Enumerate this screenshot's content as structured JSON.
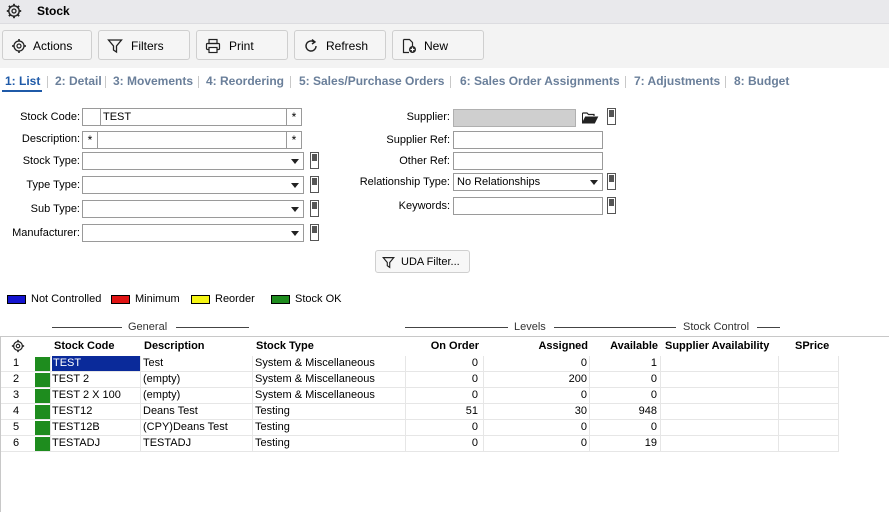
{
  "window": {
    "title": "Stock"
  },
  "toolbar": {
    "actions": "Actions",
    "filters": "Filters",
    "print": "Print",
    "refresh": "Refresh",
    "new": "New"
  },
  "tabs": [
    {
      "label": "1: List"
    },
    {
      "label": "2: Detail"
    },
    {
      "label": "3: Movements"
    },
    {
      "label": "4: Reordering"
    },
    {
      "label": "5: Sales/Purchase Orders"
    },
    {
      "label": "6: Sales Order Assignments"
    },
    {
      "label": "7: Adjustments"
    },
    {
      "label": "8: Budget"
    }
  ],
  "form": {
    "stock_code_label": "Stock Code:",
    "stock_code_value": "TEST",
    "description_label": "Description:",
    "stock_type_label": "Stock Type:",
    "type_type_label": "Type Type:",
    "sub_type_label": "Sub Type:",
    "manufacturer_label": "Manufacturer:",
    "supplier_label": "Supplier:",
    "supplier_ref_label": "Supplier Ref:",
    "other_ref_label": "Other Ref:",
    "relationship_type_label": "Relationship Type:",
    "relationship_type_value": "No Relationships",
    "keywords_label": "Keywords:",
    "asterisk": "*",
    "uda_filter": "UDA Filter..."
  },
  "legend": [
    {
      "label": "Not Controlled",
      "color": "#1414d0"
    },
    {
      "label": "Minimum",
      "color": "#e01414"
    },
    {
      "label": "Reorder",
      "color": "#f5f514"
    },
    {
      "label": "Stock OK",
      "color": "#1e8c1e"
    }
  ],
  "groups": {
    "general": "General",
    "levels": "Levels",
    "stock_control": "Stock Control"
  },
  "table": {
    "headers": {
      "stock_code": "Stock Code",
      "description": "Description",
      "stock_type": "Stock Type",
      "on_order": "On Order",
      "assigned": "Assigned",
      "available": "Available",
      "supplier_availability": "Supplier Availability",
      "sprice": "SPrice"
    },
    "rows": [
      {
        "n": "1",
        "code": "TEST",
        "desc": "Test",
        "type": "System & Miscellaneous",
        "on_order": "0",
        "assigned": "0",
        "available": "1"
      },
      {
        "n": "2",
        "code": "TEST 2",
        "desc": "(empty)",
        "type": "System & Miscellaneous",
        "on_order": "0",
        "assigned": "200",
        "available": "0"
      },
      {
        "n": "3",
        "code": "TEST 2 X 100",
        "desc": "(empty)",
        "type": "System & Miscellaneous",
        "on_order": "0",
        "assigned": "0",
        "available": "0"
      },
      {
        "n": "4",
        "code": "TEST12",
        "desc": "Deans Test",
        "type": "Testing",
        "on_order": "51",
        "assigned": "30",
        "available": "948"
      },
      {
        "n": "5",
        "code": "TEST12B",
        "desc": "(CPY)Deans Test",
        "type": "Testing",
        "on_order": "0",
        "assigned": "0",
        "available": "0"
      },
      {
        "n": "6",
        "code": "TESTADJ",
        "desc": "TESTADJ",
        "type": "Testing",
        "on_order": "0",
        "assigned": "0",
        "available": "19"
      }
    ],
    "status_color": "#1e8c1e",
    "selected_color": "#0a2a9a"
  }
}
